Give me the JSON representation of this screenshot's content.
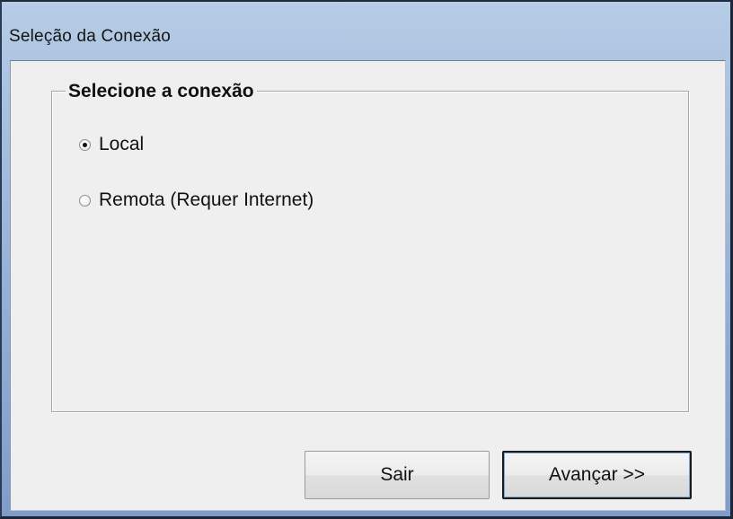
{
  "window": {
    "title": "Seleção da Conexão"
  },
  "group": {
    "label": "Selecione a conexão",
    "options": [
      {
        "label": "Local",
        "selected": true
      },
      {
        "label": "Remota (Requer Internet)",
        "selected": false
      }
    ]
  },
  "buttons": {
    "exit_label": "Sair",
    "next_label": "Avançar >>"
  }
}
